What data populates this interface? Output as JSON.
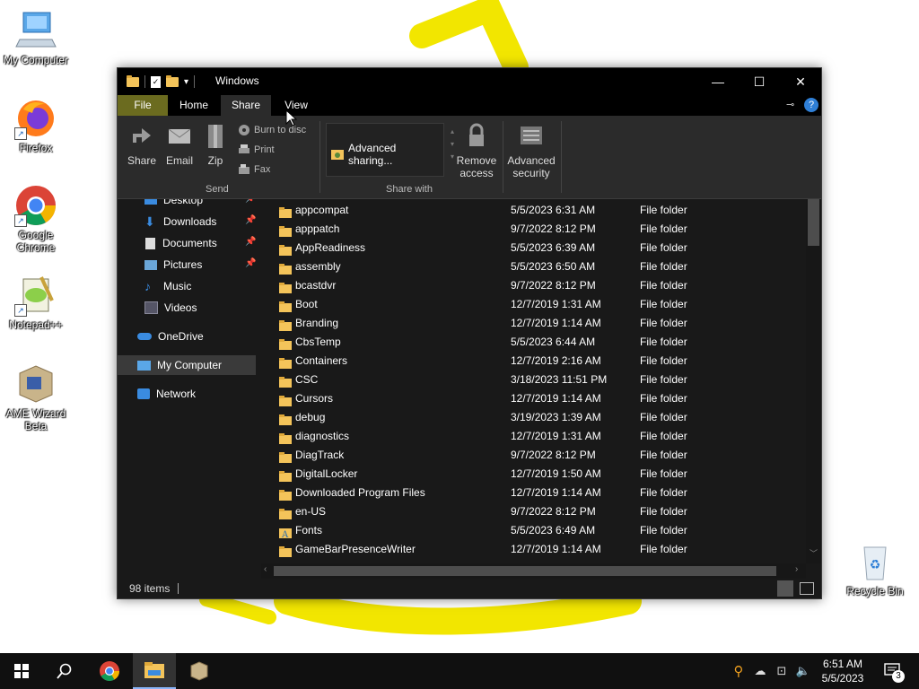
{
  "desktop": {
    "icons": [
      {
        "label": "My Computer",
        "icon": "computer-icon"
      },
      {
        "label": "Firefox",
        "icon": "firefox-icon"
      },
      {
        "label": "Google Chrome",
        "icon": "chrome-icon"
      },
      {
        "label": "Notepad++",
        "icon": "notepadpp-icon"
      },
      {
        "label": "AME Wizard Beta",
        "icon": "ame-wizard-icon"
      },
      {
        "label": "Recycle Bin",
        "icon": "recycle-bin-icon"
      }
    ]
  },
  "window": {
    "title": "Windows",
    "controls": {
      "minimize": "—",
      "maximize": "☐",
      "close": "✕"
    },
    "tabs": [
      "File",
      "Home",
      "Share",
      "View"
    ],
    "active_tab": "Share",
    "ribbon": {
      "share": "Share",
      "email": "Email",
      "zip": "Zip",
      "burn": "Burn to disc",
      "print": "Print",
      "fax": "Fax",
      "group_send": "Send",
      "advanced_sharing": "Advanced sharing...",
      "group_share_with": "Share with",
      "remove_access_1": "Remove",
      "remove_access_2": "access",
      "advanced_security_1": "Advanced",
      "advanced_security_2": "security"
    },
    "nav": [
      {
        "label": "Desktop",
        "pinned": true
      },
      {
        "label": "Downloads",
        "pinned": true
      },
      {
        "label": "Documents",
        "pinned": true
      },
      {
        "label": "Pictures",
        "pinned": true
      },
      {
        "label": "Music",
        "pinned": false
      },
      {
        "label": "Videos",
        "pinned": false
      },
      {
        "label": "OneDrive",
        "pinned": false
      },
      {
        "label": "My Computer",
        "pinned": false
      },
      {
        "label": "Network",
        "pinned": false
      }
    ],
    "files": [
      {
        "name": "appcompat",
        "date": "5/5/2023 6:31 AM",
        "type": "File folder"
      },
      {
        "name": "apppatch",
        "date": "9/7/2022 8:12 PM",
        "type": "File folder"
      },
      {
        "name": "AppReadiness",
        "date": "5/5/2023 6:39 AM",
        "type": "File folder"
      },
      {
        "name": "assembly",
        "date": "5/5/2023 6:50 AM",
        "type": "File folder"
      },
      {
        "name": "bcastdvr",
        "date": "9/7/2022 8:12 PM",
        "type": "File folder"
      },
      {
        "name": "Boot",
        "date": "12/7/2019 1:31 AM",
        "type": "File folder"
      },
      {
        "name": "Branding",
        "date": "12/7/2019 1:14 AM",
        "type": "File folder"
      },
      {
        "name": "CbsTemp",
        "date": "5/5/2023 6:44 AM",
        "type": "File folder"
      },
      {
        "name": "Containers",
        "date": "12/7/2019 2:16 AM",
        "type": "File folder"
      },
      {
        "name": "CSC",
        "date": "3/18/2023 11:51 PM",
        "type": "File folder"
      },
      {
        "name": "Cursors",
        "date": "12/7/2019 1:14 AM",
        "type": "File folder"
      },
      {
        "name": "debug",
        "date": "3/19/2023 1:39 AM",
        "type": "File folder"
      },
      {
        "name": "diagnostics",
        "date": "12/7/2019 1:31 AM",
        "type": "File folder"
      },
      {
        "name": "DiagTrack",
        "date": "9/7/2022 8:12 PM",
        "type": "File folder"
      },
      {
        "name": "DigitalLocker",
        "date": "12/7/2019 1:50 AM",
        "type": "File folder"
      },
      {
        "name": "Downloaded Program Files",
        "date": "12/7/2019 1:14 AM",
        "type": "File folder"
      },
      {
        "name": "en-US",
        "date": "9/7/2022 8:12 PM",
        "type": "File folder"
      },
      {
        "name": "Fonts",
        "date": "5/5/2023 6:49 AM",
        "type": "File folder"
      },
      {
        "name": "GameBarPresenceWriter",
        "date": "12/7/2019 1:14 AM",
        "type": "File folder"
      }
    ],
    "status": "98 items"
  },
  "taskbar": {
    "time": "6:51 AM",
    "date": "5/5/2023",
    "notifications": "3"
  },
  "colors": {
    "accent": "#f2e600",
    "file_tab": "#6b6b1f",
    "folder": "#f4c45a"
  }
}
